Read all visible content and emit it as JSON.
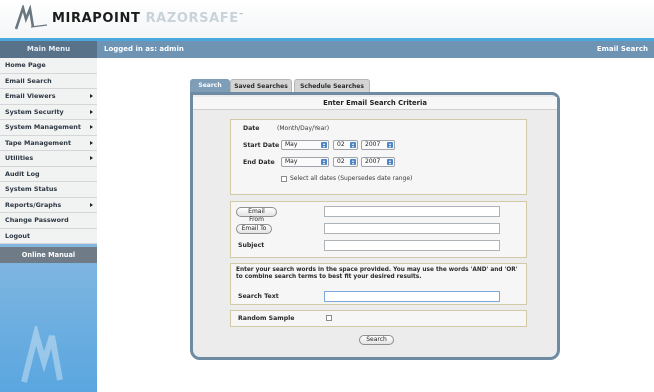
{
  "header": {
    "brand_primary": "MIRAPOINT",
    "brand_secondary": "RAZORSAFE",
    "brand_tm": "™",
    "colors": {
      "accent_bar": "#4aa8df",
      "topbar": "#6e93b3",
      "tab_active": "#7d9db9",
      "panel_border": "#6f8aa3"
    }
  },
  "topbar": {
    "menu_title": "Main Menu",
    "logged_in": "Logged in as: admin",
    "page_label": "Email Search"
  },
  "sidebar": {
    "items": [
      {
        "label": "Home Page",
        "has_submenu": false
      },
      {
        "label": "Email Search",
        "has_submenu": false
      },
      {
        "label": "Email Viewers",
        "has_submenu": true
      },
      {
        "label": "System Security",
        "has_submenu": true
      },
      {
        "label": "System Management",
        "has_submenu": true
      },
      {
        "label": "Tape Management",
        "has_submenu": true
      },
      {
        "label": "Utilities",
        "has_submenu": true
      },
      {
        "label": "Audit Log",
        "has_submenu": false
      },
      {
        "label": "System Status",
        "has_submenu": false
      },
      {
        "label": "Reports/Graphs",
        "has_submenu": true
      },
      {
        "label": "Change Password",
        "has_submenu": false
      },
      {
        "label": "Logout",
        "has_submenu": false
      }
    ],
    "online_manual": "Online Manual"
  },
  "tabs": [
    {
      "label": "Search",
      "active": true
    },
    {
      "label": "Saved Searches",
      "active": false
    },
    {
      "label": "Schedule Searches",
      "active": false
    }
  ],
  "form": {
    "title": "Enter Email Search Criteria",
    "date_label": "Date",
    "date_hint": "(Month/Day/Year)",
    "start_date_label": "Start Date",
    "start_month": "May",
    "start_day": "02",
    "start_year": "2007",
    "end_date_label": "End Date",
    "end_month": "May",
    "end_day": "02",
    "end_year": "2007",
    "select_all_dates": "Select all dates (Supersedes date range)",
    "email_from_button": "Email From",
    "email_from_value": "",
    "email_to_button": "Email To",
    "email_to_value": "",
    "subject_label": "Subject",
    "subject_value": "",
    "instructions": "Enter your search words in the space provided. You may use the words 'AND' and 'OR' to combine search terms to best fit your desired results.",
    "search_text_label": "Search Text",
    "search_text_value": "",
    "random_sample_label": "Random Sample",
    "search_button": "Search"
  }
}
